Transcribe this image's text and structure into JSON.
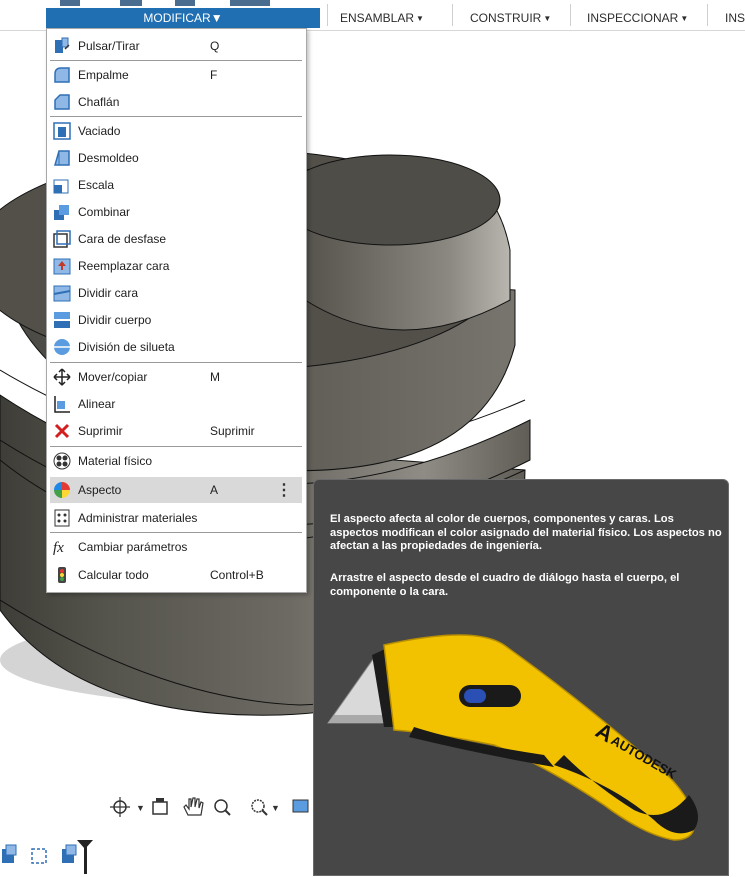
{
  "toolbar": {
    "tabs": [
      {
        "label": "MODIFICAR",
        "active": true
      },
      {
        "label": "ENSAMBLAR"
      },
      {
        "label": "CONSTRUIR"
      },
      {
        "label": "INSPECCIONAR"
      },
      {
        "label": "INS"
      }
    ],
    "accent": "#1f6fb2"
  },
  "menu": {
    "items": [
      {
        "label": "Pulsar/Tirar",
        "shortcut": "Q",
        "icon": "press-pull-icon"
      },
      {
        "label": "Empalme",
        "shortcut": "F",
        "icon": "fillet-icon"
      },
      {
        "label": "Chaflán",
        "shortcut": "",
        "icon": "chamfer-icon"
      },
      {
        "label": "Vaciado",
        "shortcut": "",
        "icon": "shell-icon"
      },
      {
        "label": "Desmoldeo",
        "shortcut": "",
        "icon": "draft-icon"
      },
      {
        "label": "Escala",
        "shortcut": "",
        "icon": "scale-icon"
      },
      {
        "label": "Combinar",
        "shortcut": "",
        "icon": "combine-icon"
      },
      {
        "label": "Cara de desfase",
        "shortcut": "",
        "icon": "offset-face-icon"
      },
      {
        "label": "Reemplazar cara",
        "shortcut": "",
        "icon": "replace-face-icon"
      },
      {
        "label": "Dividir cara",
        "shortcut": "",
        "icon": "split-face-icon"
      },
      {
        "label": "Dividir cuerpo",
        "shortcut": "",
        "icon": "split-body-icon"
      },
      {
        "label": "División de silueta",
        "shortcut": "",
        "icon": "silhouette-split-icon"
      },
      {
        "label": "Mover/copiar",
        "shortcut": "M",
        "icon": "move-icon"
      },
      {
        "label": "Alinear",
        "shortcut": "",
        "icon": "align-icon"
      },
      {
        "label": "Suprimir",
        "shortcut": "Suprimir",
        "icon": "delete-icon"
      },
      {
        "label": "Material físico",
        "shortcut": "",
        "icon": "physical-material-icon"
      },
      {
        "label": "Aspecto",
        "shortcut": "A",
        "icon": "appearance-icon",
        "highlighted": true
      },
      {
        "label": "Administrar materiales",
        "shortcut": "",
        "icon": "manage-materials-icon"
      },
      {
        "label": "Cambiar parámetros",
        "shortcut": "",
        "icon": "fx-parameters-icon"
      },
      {
        "label": "Calcular todo",
        "shortcut": "Control+B",
        "icon": "compute-all-icon"
      }
    ]
  },
  "tooltip": {
    "paragraph1": "El aspecto afecta al color de cuerpos, componentes y caras. Los aspectos modifican el color asignado del material físico. Los aspectos no afectan a las propiedades de ingeniería.",
    "paragraph2": "Arrastre el aspecto desde el cuadro de diálogo hasta el cuerpo, el componente o la cara.",
    "image_brand": "AUTODESK"
  }
}
